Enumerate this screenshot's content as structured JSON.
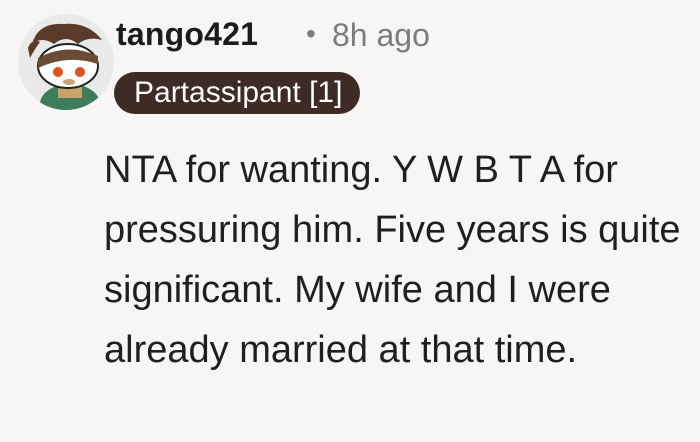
{
  "comment": {
    "author": "tango421",
    "separator": "•",
    "timestamp": "8h ago",
    "flair": "Partassipant [1]",
    "body": "NTA for wanting. Y W B T A for pressuring him. Five years is quite significant. My wife and I were already married at that time."
  },
  "colors": {
    "flair_bg": "#3d2b24",
    "meta_text": "#7c7c7c",
    "background": "#f8f6f5"
  },
  "icons": {
    "avatar": "snoo-avatar-with-bandana"
  }
}
